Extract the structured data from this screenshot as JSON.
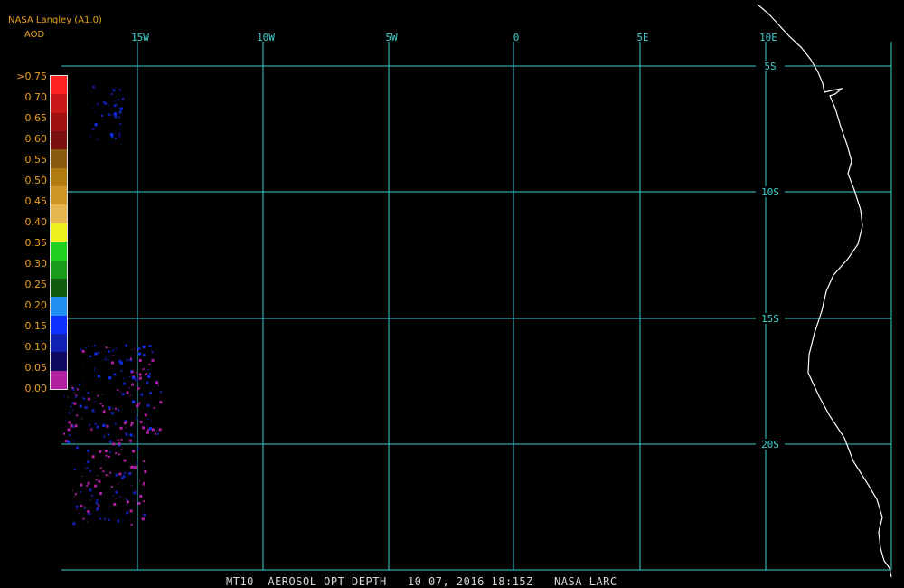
{
  "header": {
    "title": "NASA Langley (A1.0)",
    "subtitle": "AOD"
  },
  "legend": {
    "labels": [
      ">0.75",
      "0.70",
      "0.65",
      "0.60",
      "0.55",
      "0.50",
      "0.45",
      "0.40",
      "0.35",
      "0.30",
      "0.25",
      "0.20",
      "0.15",
      "0.10",
      "0.05",
      "0.00"
    ],
    "colors": [
      "#ff2020",
      "#c81818",
      "#a01010",
      "#7a1010",
      "#8a5a10",
      "#b07c10",
      "#d09628",
      "#e8b850",
      "#f0f020",
      "#20d020",
      "#1a9a1a",
      "#0f5a0f",
      "#2090f0",
      "#1030ff",
      "#1020b0",
      "#100a60",
      "#b020a0"
    ]
  },
  "map": {
    "lon_labels": [
      "15W",
      "10W",
      "5W",
      "0",
      "5E",
      "10E"
    ],
    "lat_labels": [
      "5S",
      "10S",
      "15S",
      "20S"
    ],
    "grid_color": "#40d0d0",
    "coast_color": "#ffffff"
  },
  "footer": {
    "caption": "MT10  AEROSOL OPT DEPTH   10 07, 2016 18:15Z   NASA LARC"
  }
}
